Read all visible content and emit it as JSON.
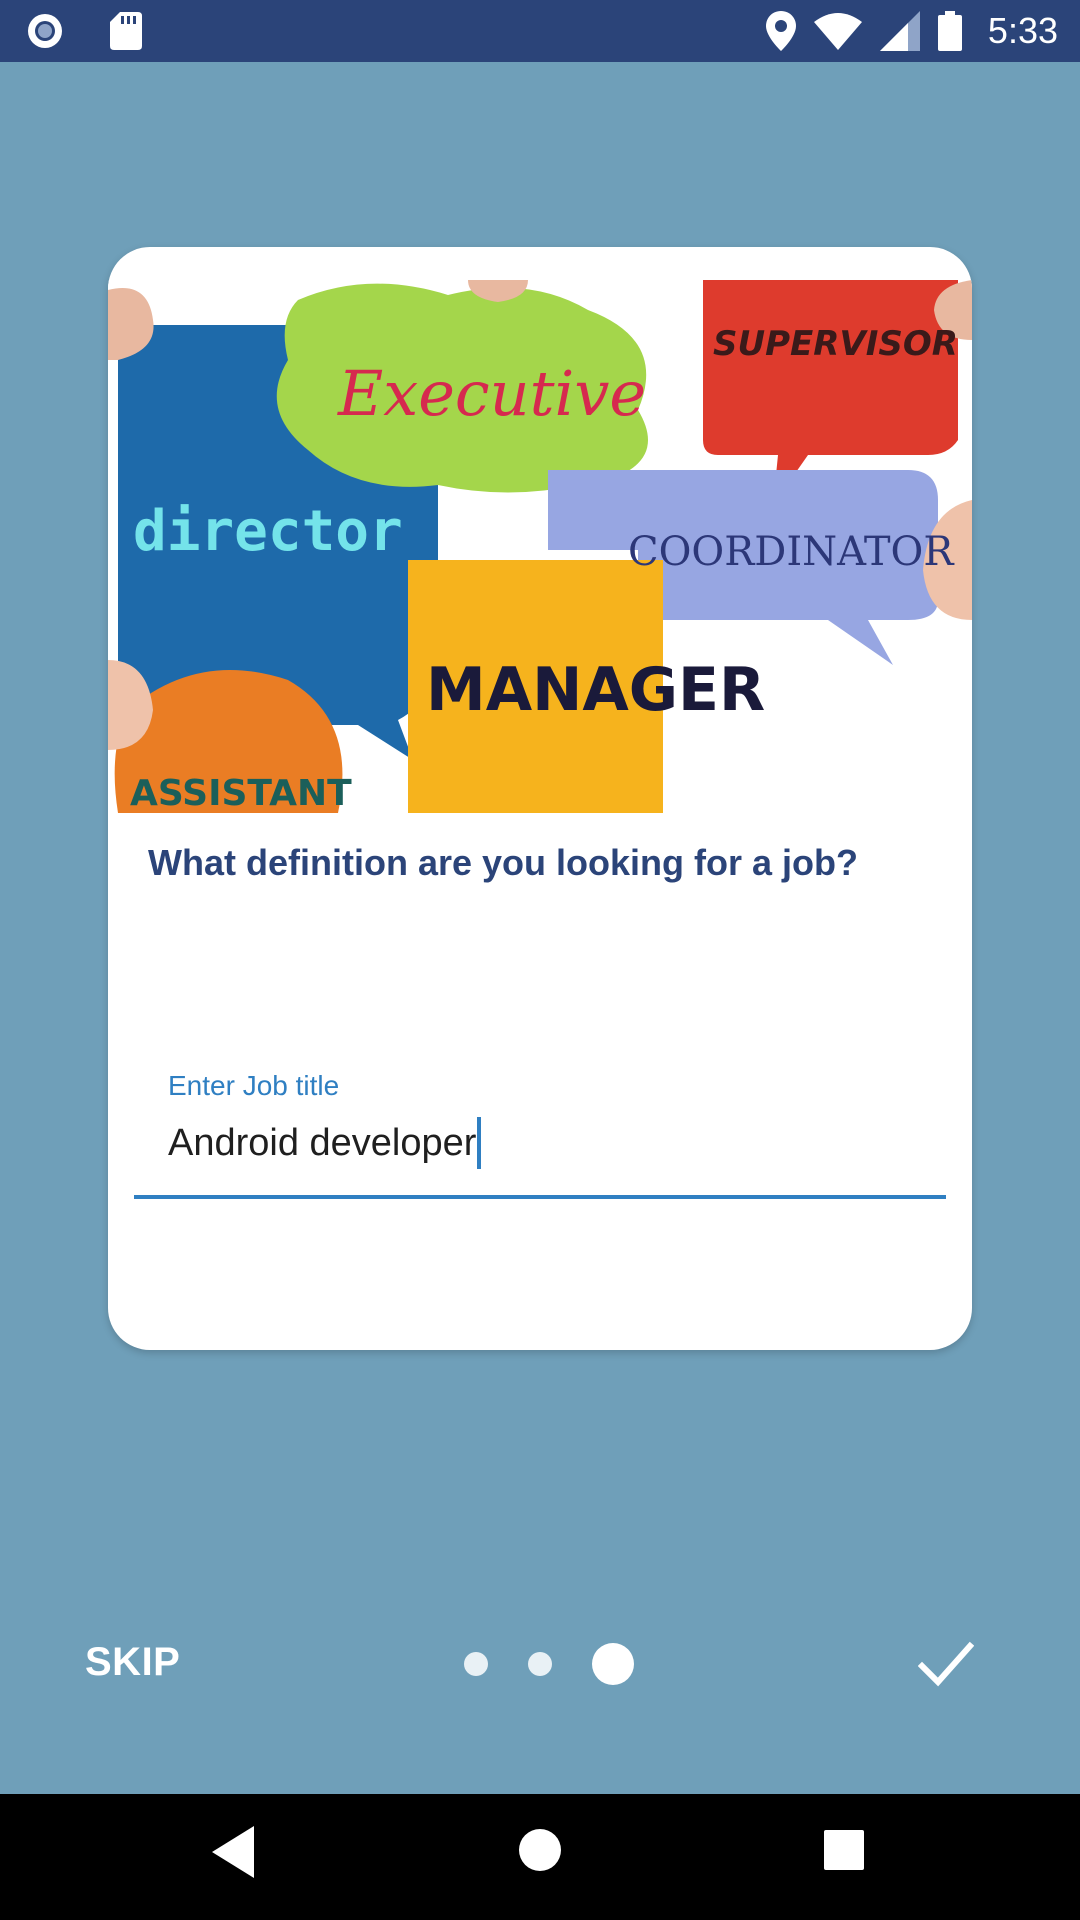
{
  "status_bar": {
    "time": "5:33",
    "left_icons": [
      "record-icon",
      "sd-card-icon"
    ],
    "right_icons": [
      "location-icon",
      "wifi-icon",
      "signal-icon",
      "battery-icon"
    ]
  },
  "card": {
    "image_words": [
      "Executive",
      "SUPERVISOR",
      "director",
      "COORDINATOR",
      "MANAGER",
      "ASSISTANT"
    ],
    "question": "What definition are you looking for a job?",
    "job_field": {
      "label": "Enter Job title",
      "value": "Android developer"
    }
  },
  "footer": {
    "skip_label": "SKIP",
    "page_indicator": {
      "total": 3,
      "current": 3
    },
    "done_icon": "check-icon"
  },
  "nav_bar": {
    "buttons": [
      "back-icon",
      "home-icon",
      "recents-icon"
    ]
  },
  "colors": {
    "status_bar": "#2b4479",
    "background": "#6f9fb9",
    "accent": "#2f7fc2",
    "question_text": "#2b4479"
  }
}
